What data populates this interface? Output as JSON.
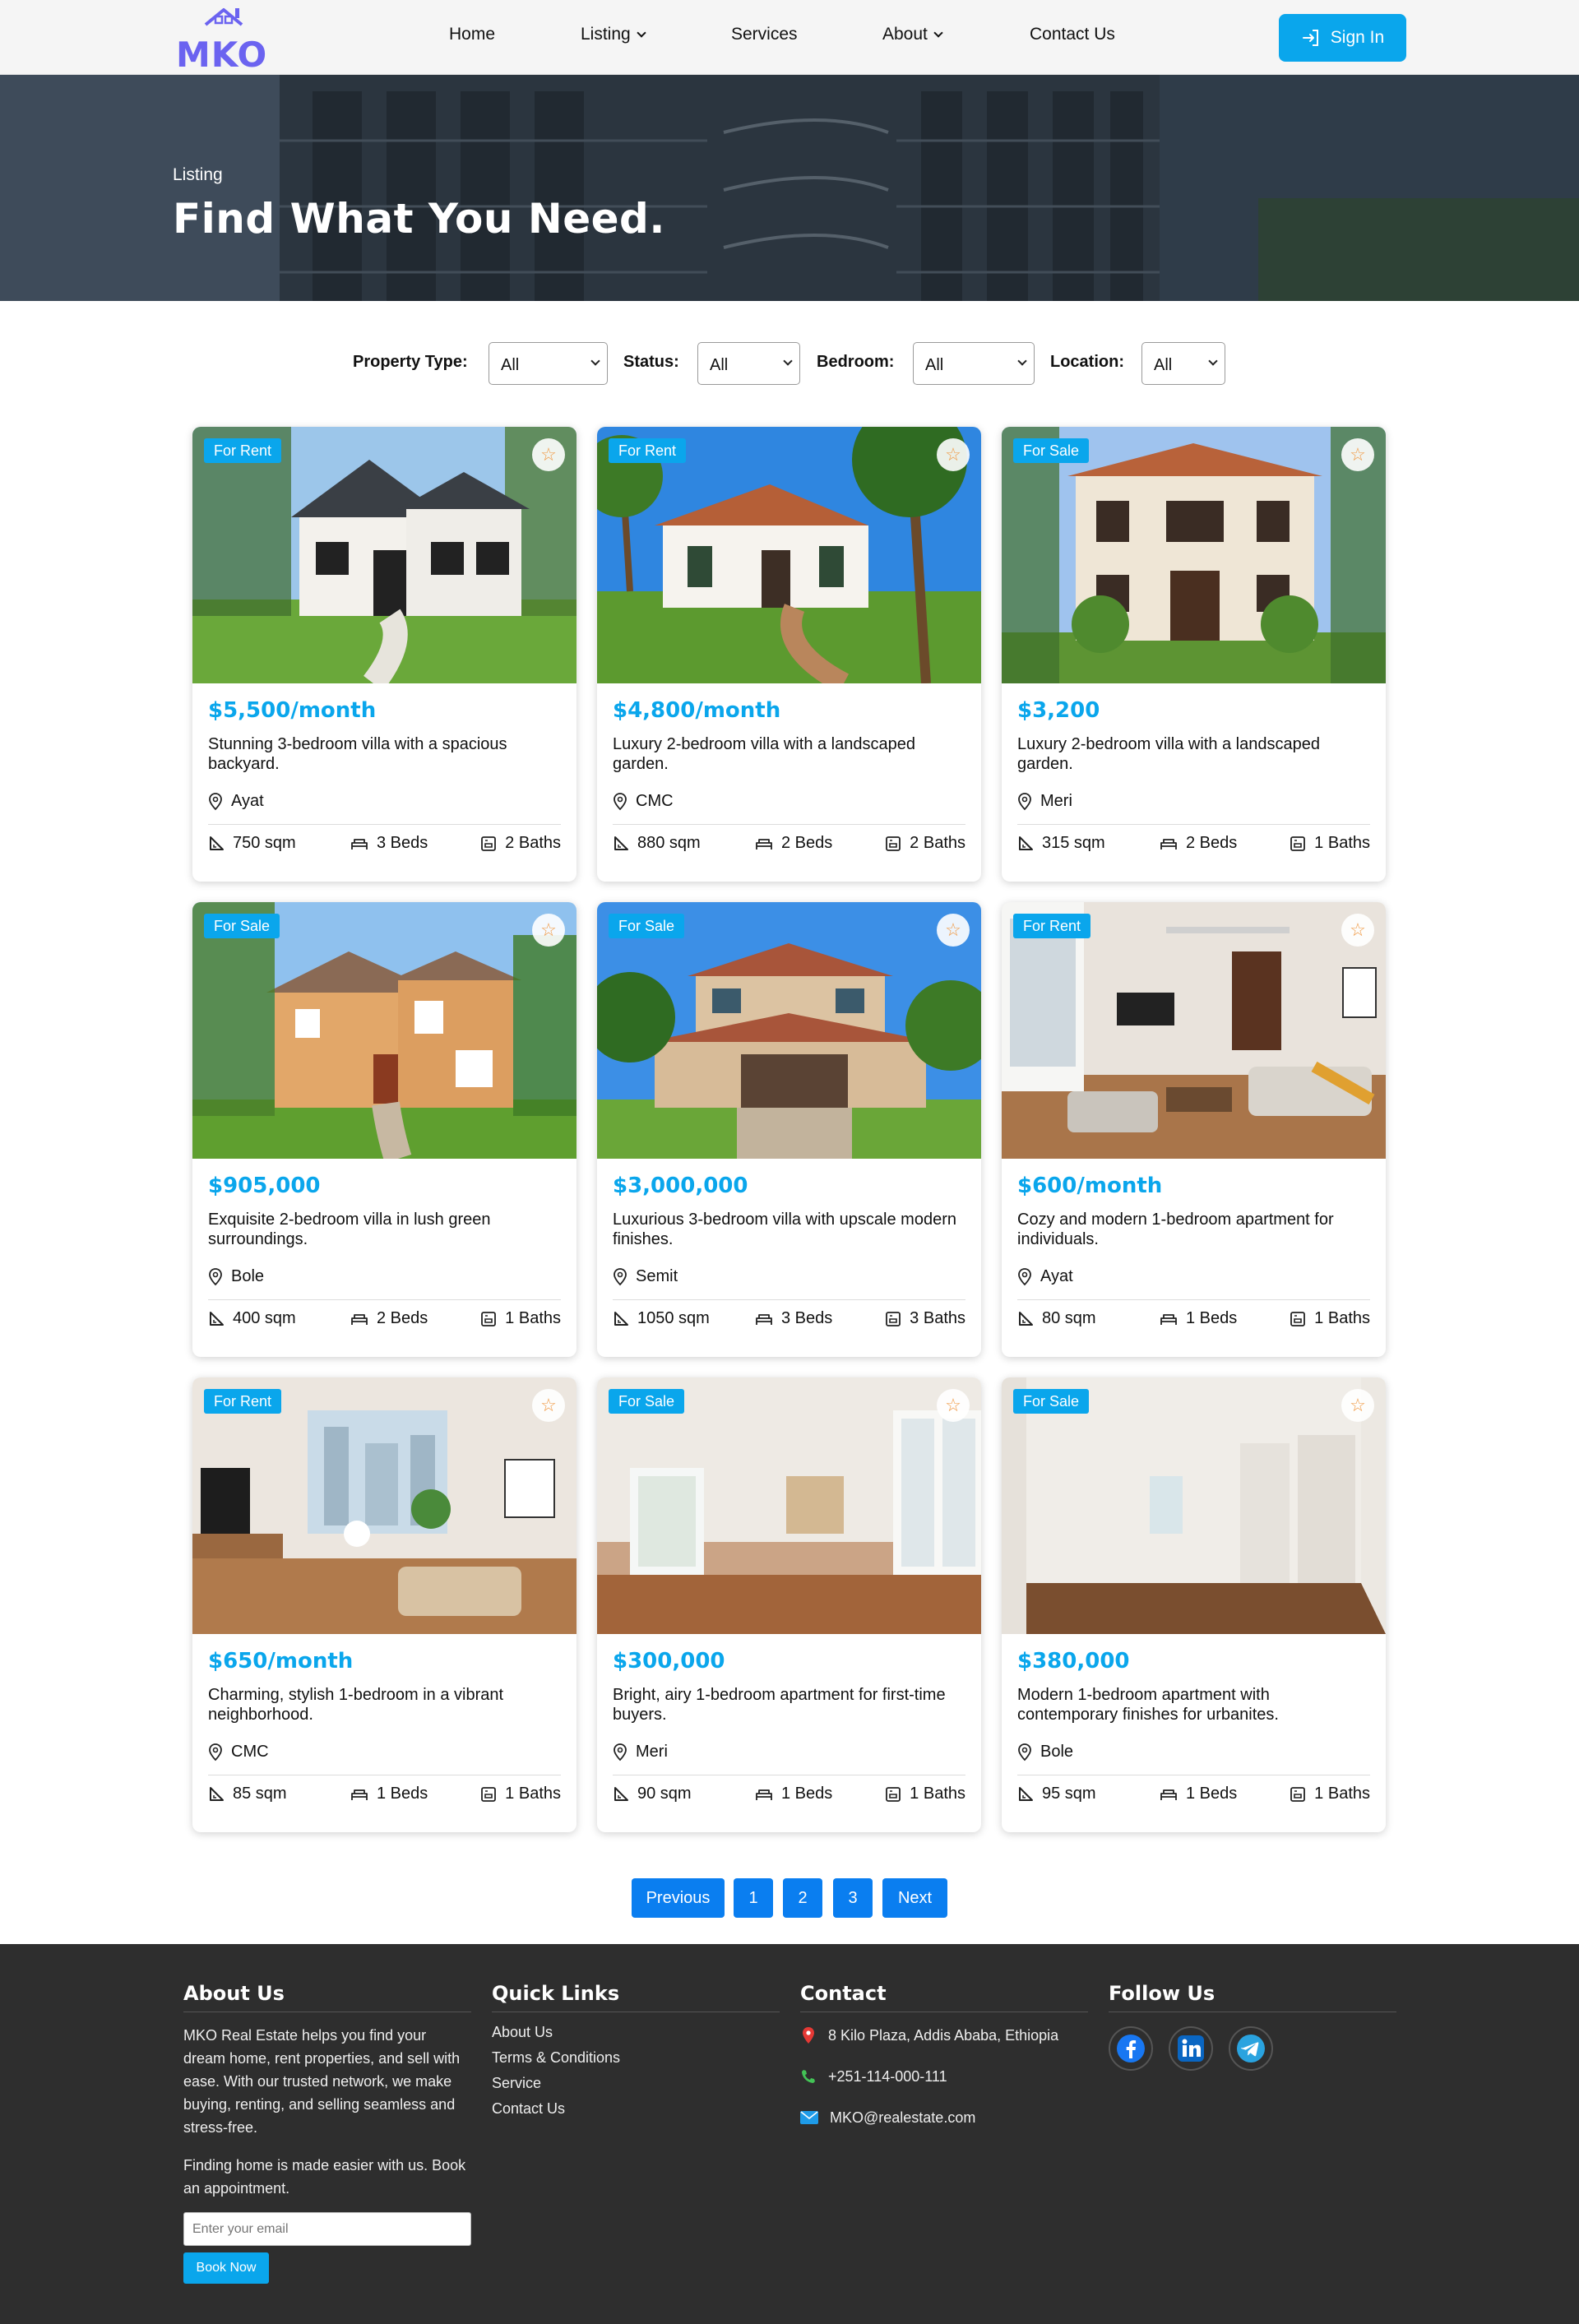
{
  "header": {
    "logo_text": "MKO",
    "nav": [
      {
        "label": "Home"
      },
      {
        "label": "Listing"
      },
      {
        "label": "Services"
      },
      {
        "label": "About"
      },
      {
        "label": "Contact Us"
      }
    ],
    "signin_label": "Sign In"
  },
  "hero": {
    "label": "Listing",
    "title": "Find What You Need."
  },
  "filters": {
    "property_type_label": "Property Type:",
    "property_type_value": "All",
    "status_label": "Status:",
    "status_value": "All",
    "bedroom_label": "Bedroom:",
    "bedroom_value": "All",
    "location_label": "Location:",
    "location_value": "All"
  },
  "listings": [
    {
      "badge": "For Rent",
      "price": "$5,500/month",
      "description": "Stunning 3-bedroom villa with a spacious backyard.",
      "location": "Ayat",
      "area": "750 sqm",
      "beds": "3 Beds",
      "baths": "2 Baths"
    },
    {
      "badge": "For Rent",
      "price": "$4,800/month",
      "description": "Luxury 2-bedroom villa with a landscaped garden.",
      "location": "CMC",
      "area": "880 sqm",
      "beds": "2 Beds",
      "baths": "2 Baths"
    },
    {
      "badge": "For Sale",
      "price": "$3,200",
      "description": "Luxury 2-bedroom villa with a landscaped garden.",
      "location": "Meri",
      "area": "315 sqm",
      "beds": "2 Beds",
      "baths": "1 Baths"
    },
    {
      "badge": "For Sale",
      "price": "$905,000",
      "description": "Exquisite 2-bedroom villa in lush green surroundings.",
      "location": "Bole",
      "area": "400 sqm",
      "beds": "2 Beds",
      "baths": "1 Baths"
    },
    {
      "badge": "For Sale",
      "price": "$3,000,000",
      "description": "Luxurious 3-bedroom villa with upscale modern finishes.",
      "location": "Semit",
      "area": "1050 sqm",
      "beds": "3 Beds",
      "baths": "3 Baths"
    },
    {
      "badge": "For Rent",
      "price": "$600/month",
      "description": "Cozy and modern 1-bedroom apartment for individuals.",
      "location": "Ayat",
      "area": "80 sqm",
      "beds": "1 Beds",
      "baths": "1 Baths"
    },
    {
      "badge": "For Rent",
      "price": "$650/month",
      "description": "Charming, stylish 1-bedroom in a vibrant neighborhood.",
      "location": "CMC",
      "area": "85 sqm",
      "beds": "1 Beds",
      "baths": "1 Baths"
    },
    {
      "badge": "For Sale",
      "price": "$300,000",
      "description": "Bright, airy 1-bedroom apartment for first-time buyers.",
      "location": "Meri",
      "area": "90 sqm",
      "beds": "1 Beds",
      "baths": "1 Baths"
    },
    {
      "badge": "For Sale",
      "price": "$380,000",
      "description": "Modern 1-bedroom apartment with contemporary finishes for urbanites.",
      "location": "Bole",
      "area": "95 sqm",
      "beds": "1 Beds",
      "baths": "1 Baths"
    }
  ],
  "pagination": {
    "previous": "Previous",
    "pages": [
      "1",
      "2",
      "3"
    ],
    "next": "Next"
  },
  "footer": {
    "about_title": "About Us",
    "about_text": "MKO Real Estate helps you find your dream home, rent properties, and sell with ease. With our trusted network, we make buying, renting, and selling seamless and stress-free.",
    "about_text2": "Finding home is made easier with us. Book an appointment.",
    "email_placeholder": "Enter your email",
    "book_label": "Book Now",
    "quick_title": "Quick Links",
    "quick_links": [
      "About Us",
      "Terms & Conditions",
      "Service",
      "Contact Us"
    ],
    "contact_title": "Contact",
    "address": "8 Kilo Plaza, Addis Ababa, Ethiopia",
    "phone": "+251-114-000-111",
    "email": "MKO@realestate.com",
    "follow_title": "Follow Us"
  },
  "icons": {
    "favorite": "star-icon",
    "location": "map-pin-icon",
    "area": "set-square-icon",
    "beds": "bed-icon",
    "baths": "bath-icon",
    "signin": "login-arrow-icon",
    "social": [
      "facebook-icon",
      "linkedin-icon",
      "telegram-icon"
    ]
  },
  "colors": {
    "accent": "#0aa6ec",
    "pager": "#0a7ef0",
    "logo": "#6b63f0",
    "footer_bg": "#2e2e2e",
    "favorite_star": "#f09a45"
  }
}
